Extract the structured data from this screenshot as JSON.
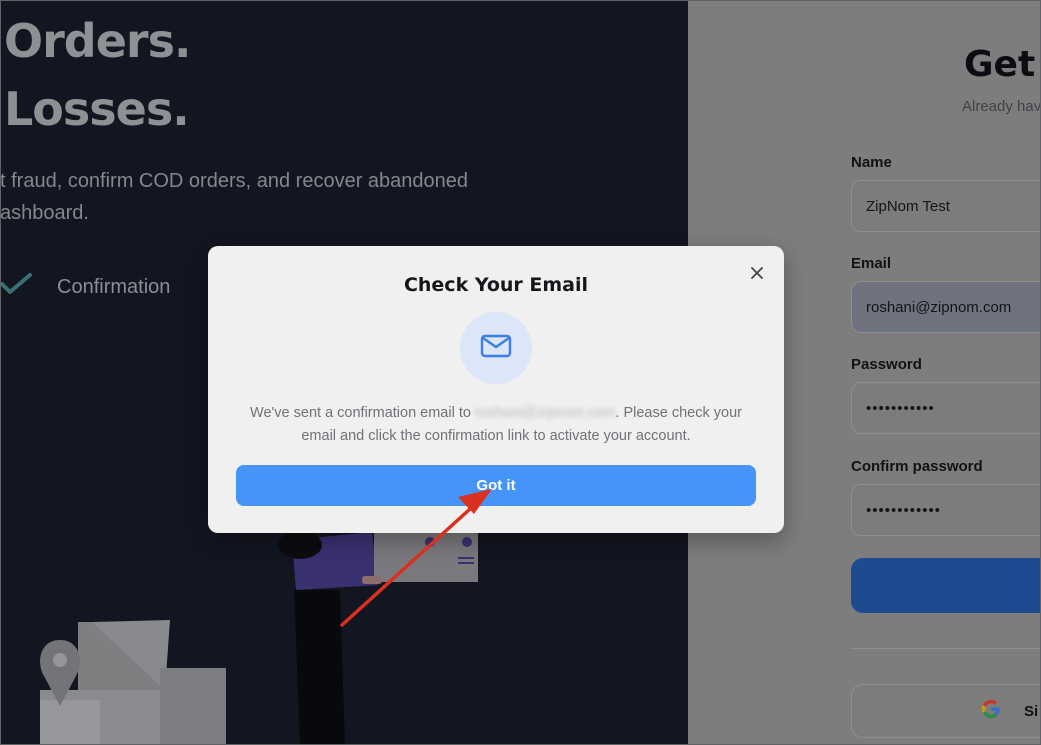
{
  "hero": {
    "line1": "Orders.",
    "line2": "Losses.",
    "subtitle_line1": "t fraud, confirm COD orders, and recover abandoned",
    "subtitle_line2": "ashboard.",
    "feature_label": "Confirmation",
    "feature_icon": "checkmark-icon"
  },
  "signup_form": {
    "title": "Get",
    "subtitle": "Already hav",
    "name_label": "Name",
    "name_value": "ZipNom Test",
    "email_label": "Email",
    "email_value": "roshani@zipnom.com",
    "password_label": "Password",
    "password_value": "•••••••••••",
    "confirm_password_label": "Confirm password",
    "confirm_password_value": "••••••••••••",
    "google_button_label": "Si",
    "google_icon": "google-icon"
  },
  "modal": {
    "title": "Check Your Email",
    "icon": "mail-icon",
    "message_before": "We've sent a confirmation email to ",
    "message_email": "roshani@zipnom.com",
    "message_after": ". Please check your email and click the confirmation link to activate your account.",
    "confirm_button_label": "Got it",
    "close_icon": "close-icon"
  },
  "colors": {
    "primary_button": "#4694f8",
    "modal_background": "#f0f0f0",
    "mail_circle": "#dbe7f8",
    "left_panel": "#121621",
    "annotation_arrow": "#d9301f"
  }
}
